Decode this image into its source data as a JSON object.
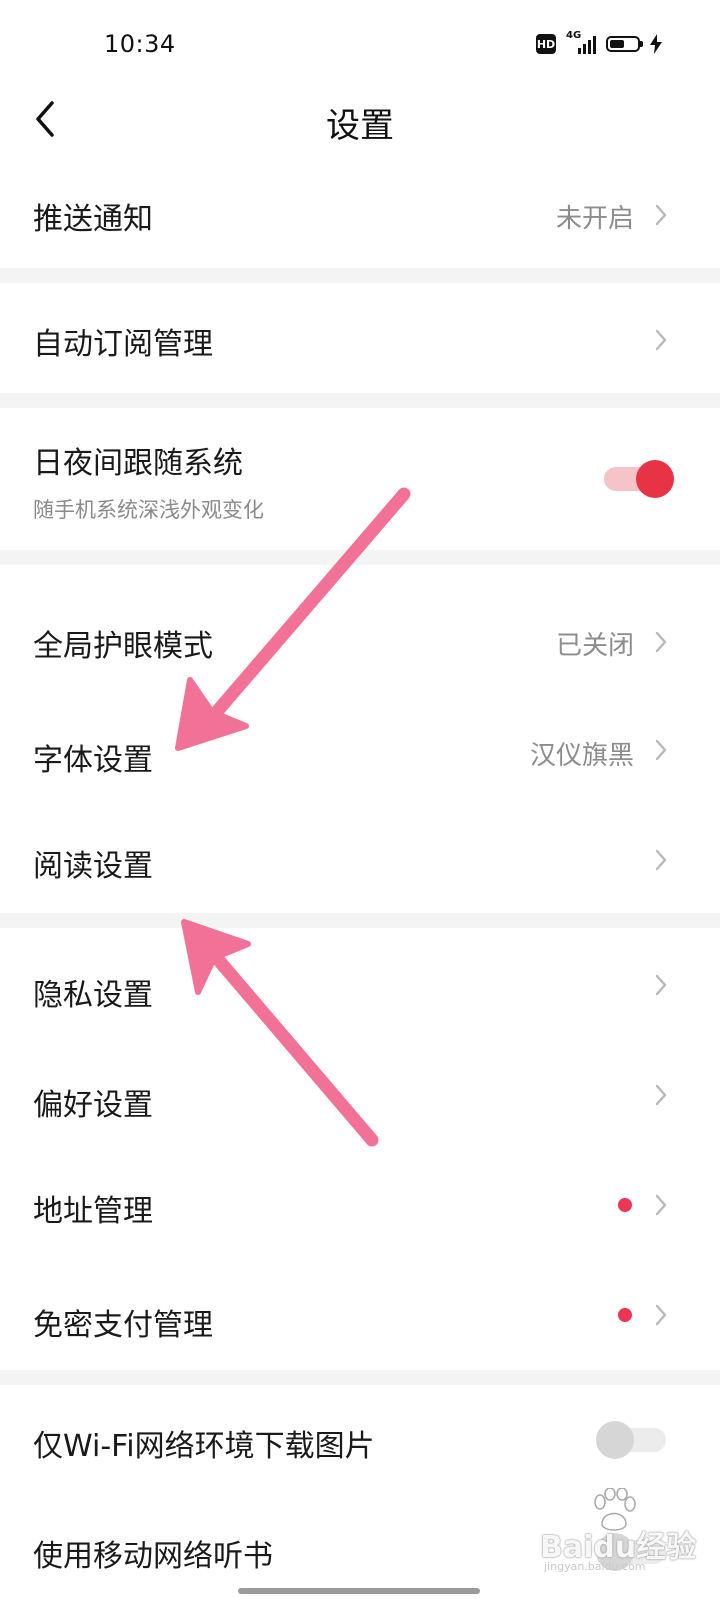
{
  "status_bar": {
    "time": "10:34",
    "hd_badge": "HD",
    "network_label": "4G",
    "battery_level": 0.55,
    "icons": [
      "hd-icon",
      "signal-4g-icon",
      "battery-icon",
      "charging-bolt-icon"
    ]
  },
  "header": {
    "title": "设置",
    "back_icon": "back-chevron-icon"
  },
  "settings": {
    "push_notifications": {
      "label": "推送通知",
      "value": "未开启"
    },
    "auto_subscribe": {
      "label": "自动订阅管理"
    },
    "follow_system_theme": {
      "label": "日夜间跟随系统",
      "subtitle": "随手机系统深浅外观变化",
      "enabled": true
    },
    "eye_protection": {
      "label": "全局护眼模式",
      "value": "已关闭"
    },
    "font_settings": {
      "label": "字体设置",
      "value": "汉仪旗黑"
    },
    "reading_settings": {
      "label": "阅读设置"
    },
    "privacy_settings": {
      "label": "隐私设置"
    },
    "preference_settings": {
      "label": "偏好设置"
    },
    "address_management": {
      "label": "地址管理",
      "badge_dot": true
    },
    "password_free_payment": {
      "label": "免密支付管理",
      "badge_dot": true
    },
    "wifi_only_images": {
      "label": "仅Wi-Fi网络环境下载图片",
      "enabled": false
    },
    "mobile_network_audio": {
      "label": "使用移动网络听书",
      "enabled": false
    }
  },
  "annotations": {
    "arrow_color": "#f27197",
    "arrow_count": 2
  },
  "watermark": {
    "text": "Baidu经验",
    "url_text": "jingyan.baidu.com"
  },
  "colors": {
    "accent_red": "#e63446",
    "badge_red": "#ec3654",
    "divider": "#f4f4f4",
    "secondary_text": "#8c8c8c"
  }
}
